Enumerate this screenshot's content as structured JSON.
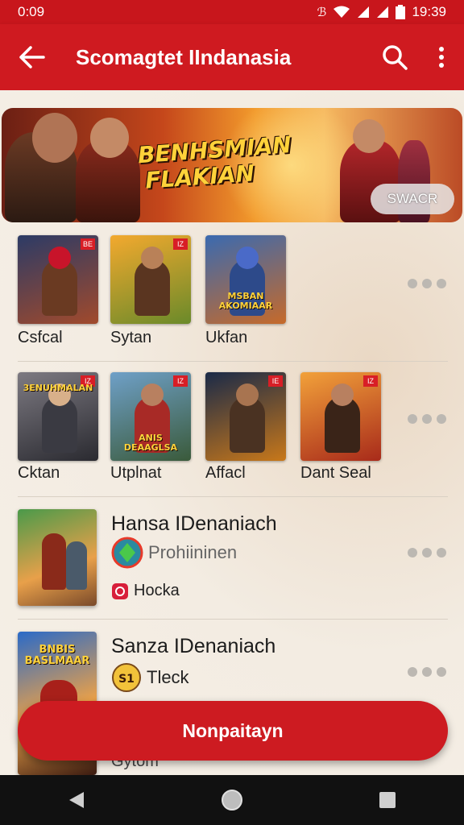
{
  "status_bar": {
    "time": "0:09",
    "clock": "19:39",
    "extra": "ℬ"
  },
  "app_bar": {
    "title": "Scomagtet IIndanasia"
  },
  "banner": {
    "title": "BENHSMIAN FLAKIAN",
    "search_label": "SWACR"
  },
  "row1": {
    "items": [
      {
        "label": "Csfcal",
        "badge": "BE",
        "caption": ""
      },
      {
        "label": "Sytan",
        "badge": "IZ",
        "caption": ""
      },
      {
        "label": "Ukfan",
        "badge": "",
        "caption": "MSBAN AKOMIAAR"
      }
    ]
  },
  "row2": {
    "items": [
      {
        "label": "Cktan",
        "badge": "IZ",
        "caption": "3ENUHMALAN"
      },
      {
        "label": "Utplnat",
        "badge": "IZ",
        "caption": "ANIS DEAAGLSA"
      },
      {
        "label": "Affacl",
        "badge": "IE",
        "caption": ""
      },
      {
        "label": "Dant Seal",
        "badge": "IZ",
        "caption": ""
      }
    ]
  },
  "list": [
    {
      "title": "Hansa IDenaniach",
      "subtitle": "Prohiininen",
      "meta": "Hocka"
    },
    {
      "title": "Sanza IDenaniach",
      "subtitle": "Tleck",
      "meta": "Gytom",
      "thumb_caption": "BNBIS BASLMAAR"
    }
  ],
  "cta": {
    "label": "Nonpaitayn"
  },
  "colors": {
    "primary": "#cf1a20",
    "background": "#f2ebe1",
    "accent": "#ffd23a"
  }
}
